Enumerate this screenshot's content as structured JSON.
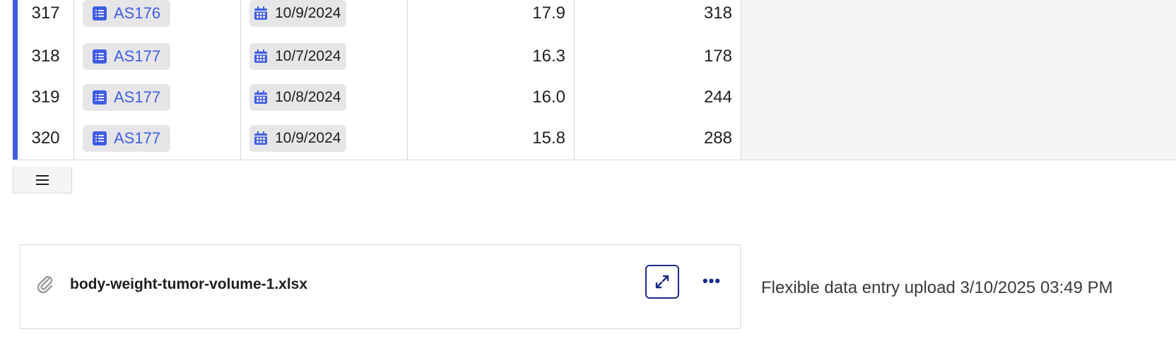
{
  "rows": [
    {
      "index": "317",
      "subject": "AS176",
      "date": "10/9/2024",
      "value1": "17.9",
      "value2": "318"
    },
    {
      "index": "318",
      "subject": "AS177",
      "date": "10/7/2024",
      "value1": "16.3",
      "value2": "178"
    },
    {
      "index": "319",
      "subject": "AS177",
      "date": "10/8/2024",
      "value1": "16.0",
      "value2": "244"
    },
    {
      "index": "320",
      "subject": "AS177",
      "date": "10/9/2024",
      "value1": "15.8",
      "value2": "288"
    }
  ],
  "row_menu_icon": "hamburger-icon",
  "accent_color": "#3f5de3",
  "link_color": "#3f5de3",
  "attachment": {
    "filename": "body-weight-tumor-volume-1.xlsx",
    "icons": {
      "attach": "paperclip-icon",
      "expand": "expand-icon",
      "more": "more-icon"
    },
    "more_label": "•••"
  },
  "upload_note": "Flexible data entry upload 3/10/2025 03:49 PM"
}
